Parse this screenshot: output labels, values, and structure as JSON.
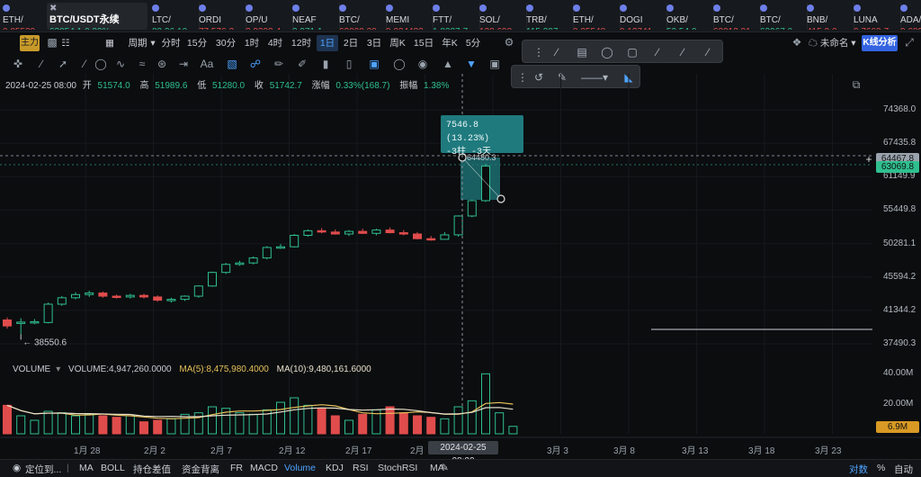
{
  "ticker": [
    {
      "name": "ETH/",
      "price": "0.05539",
      "change": "",
      "dir": "dn"
    },
    {
      "name": "BTC/USDT永续",
      "price": "63054.1",
      "change": "0.99%",
      "dir": "up",
      "active": true
    },
    {
      "name": "LTC/",
      "price": "82.26",
      "change": "10",
      "dir": "up"
    },
    {
      "name": "ORDI",
      "price": "77.576",
      "change": "3",
      "dir": "dn"
    },
    {
      "name": "OP/U",
      "price": "3.9302",
      "change": "4",
      "dir": "dn"
    },
    {
      "name": "NEAF",
      "price": "3.971",
      "change": "1",
      "dir": "up"
    },
    {
      "name": "BTC/",
      "price": "63008.30",
      "change": "",
      "dir": "dn"
    },
    {
      "name": "MEMI",
      "price": "0.034432",
      "change": "",
      "dir": "dn"
    },
    {
      "name": "FTT/",
      "price": "1.8237",
      "change": "7",
      "dir": "up"
    },
    {
      "name": "SOL/",
      "price": "128.698",
      "change": "",
      "dir": "dn"
    },
    {
      "name": "TRB/",
      "price": "115.207",
      "change": "",
      "dir": "up"
    },
    {
      "name": "ETH/",
      "price": "0.05548",
      "change": "",
      "dir": "dn"
    },
    {
      "name": "DOGI",
      "price": "0.12741",
      "change": "",
      "dir": "dn"
    },
    {
      "name": "OKB/",
      "price": "52.54",
      "change": "0.",
      "dir": "up"
    },
    {
      "name": "BTC/",
      "price": "63012.91",
      "change": "",
      "dir": "dn"
    },
    {
      "name": "BTC/",
      "price": "62967.0",
      "change": "",
      "dir": "up"
    },
    {
      "name": "BNB/",
      "price": "415.3",
      "change": "0.",
      "dir": "dn"
    },
    {
      "name": "LUNA",
      "price": "0.7660",
      "change": "7",
      "dir": "dn"
    },
    {
      "name": "ADA/",
      "price": "0.6897",
      "change": "9",
      "dir": "dn"
    },
    {
      "name": "BTC",
      "price": "63116.4",
      "change": "",
      "dir": "up"
    }
  ],
  "toolbar": {
    "main_tag": "主力",
    "period_label": "周期",
    "intervals": [
      "分时",
      "15分",
      "30分",
      "1时",
      "4时",
      "12时",
      "1日",
      "2日",
      "3日",
      "周K",
      "15日",
      "年K",
      "5分"
    ],
    "selected_interval": "1日",
    "unnamed_label": "未命名",
    "kline_analysis": "K线分析",
    "text_tool": "Aa"
  },
  "ohlc": {
    "date": "2024-02-25 08:00",
    "open_label": "开",
    "open": "51574.0",
    "high_label": "高",
    "high": "51989.6",
    "low_label": "低",
    "low": "51280.0",
    "close_label": "收",
    "close": "51742.7",
    "change_label": "涨幅",
    "change": "0.33%(168.7)",
    "amp_label": "振幅",
    "amp": "1.38%"
  },
  "measure": {
    "line1": "7546.8 (13.23%)",
    "line2": "-3柱 -3天",
    "top_price": "64480.3"
  },
  "price_axis": [
    "74368.0",
    "67435.8",
    "61149.9",
    "55449.8",
    "50281.1",
    "45594.2",
    "41344.2",
    "37490.3"
  ],
  "price_tags": {
    "cursor": "64467.8",
    "last": "63069.8",
    "vol": "6.9M"
  },
  "low_marker": "38550.6",
  "volume_axis": [
    "40.00M",
    "20.00M"
  ],
  "volume_legend": {
    "label": "VOLUME",
    "volume": "VOLUME:4,947,260.0000",
    "ma5": "MA(5):8,475,980.4000",
    "ma10": "MA(10):9,480,161.6000"
  },
  "dates": [
    "1月 28",
    "2月 2",
    "2月 7",
    "2月 12",
    "2月 17",
    "2月",
    "3月 3",
    "3月 8",
    "3月 13",
    "3月 18",
    "3月 23"
  ],
  "crosshair_date": "2024-02-25 08:00",
  "bottom": {
    "locate": "定位到...",
    "indicators": [
      "MA",
      "BOLL",
      "持仓差值",
      "资金背离",
      "FR",
      "MACD",
      "Volume",
      "KDJ",
      "RSI",
      "StochRSI",
      "MA"
    ],
    "selected": "Volume",
    "log": "对数",
    "pct": "%",
    "auto": "自动"
  },
  "colors": {
    "up": "#2fbf8e",
    "down": "#e04c4c",
    "accent": "#4fa3ff",
    "ma5": "#e6c15a",
    "ma10": "#e8e0cc",
    "measure": "#1f7a7e"
  },
  "chart_data": {
    "type": "candlestick",
    "x": [
      "1月24",
      "1月25",
      "1月26",
      "1月27",
      "1月28",
      "1月29",
      "1月30",
      "1月31",
      "2月1",
      "2月2",
      "2月3",
      "2月4",
      "2月5",
      "2月6",
      "2月7",
      "2月8",
      "2月9",
      "2月10",
      "2月11",
      "2月12",
      "2月13",
      "2月14",
      "2月15",
      "2月16",
      "2月17",
      "2月18",
      "2月19",
      "2月20",
      "2月21",
      "2月22",
      "2月23",
      "2月24",
      "2月25",
      "2月26",
      "2月27",
      "2月28"
    ],
    "open": [
      40200,
      39900,
      39950,
      39900,
      42100,
      42900,
      43300,
      43500,
      43100,
      43000,
      43200,
      43000,
      42600,
      42700,
      43100,
      44400,
      46200,
      47300,
      47500,
      48200,
      49700,
      49800,
      51500,
      52200,
      52000,
      51700,
      52100,
      51800,
      52300,
      51900,
      51700,
      51000,
      50900,
      51574,
      54500,
      57000
    ],
    "close": [
      39500,
      39950,
      40000,
      42100,
      42900,
      43300,
      43500,
      43100,
      43000,
      43200,
      43000,
      42600,
      42700,
      43100,
      44400,
      46200,
      47300,
      47500,
      48200,
      49700,
      49800,
      51500,
      52200,
      52000,
      51700,
      52100,
      51800,
      52300,
      51900,
      51700,
      51000,
      50900,
      51574,
      54500,
      57000,
      63069.8
    ],
    "high": [
      40500,
      40400,
      40300,
      42300,
      43100,
      43600,
      43800,
      43700,
      43300,
      43400,
      43400,
      43200,
      42900,
      43200,
      44500,
      46300,
      47500,
      47800,
      48400,
      49900,
      50200,
      51700,
      52400,
      52600,
      52400,
      52300,
      52500,
      52500,
      52700,
      52300,
      52000,
      51400,
      51989.6,
      54600,
      57200,
      63500
    ],
    "low": [
      39200,
      38550.6,
      39700,
      39800,
      41900,
      42700,
      43000,
      42900,
      42800,
      42800,
      42800,
      42400,
      42300,
      42500,
      42900,
      44300,
      46000,
      47100,
      47300,
      48000,
      49500,
      49700,
      51300,
      51800,
      51600,
      51400,
      51700,
      51500,
      51800,
      51500,
      50900,
      50700,
      51280,
      51300,
      54300,
      56800
    ],
    "volume": [
      19000000,
      12000000,
      9000000,
      15000000,
      14000000,
      12000000,
      13000000,
      12000000,
      11000000,
      12000000,
      8000000,
      9000000,
      10000000,
      13000000,
      14000000,
      18000000,
      17000000,
      14000000,
      13000000,
      16000000,
      21000000,
      24000000,
      19000000,
      17000000,
      12000000,
      9000000,
      13000000,
      16000000,
      18000000,
      14000000,
      12000000,
      11000000,
      10000000,
      18000000,
      22000000,
      40000000,
      14000000,
      4947260
    ],
    "ylim": [
      37490,
      74368
    ]
  }
}
